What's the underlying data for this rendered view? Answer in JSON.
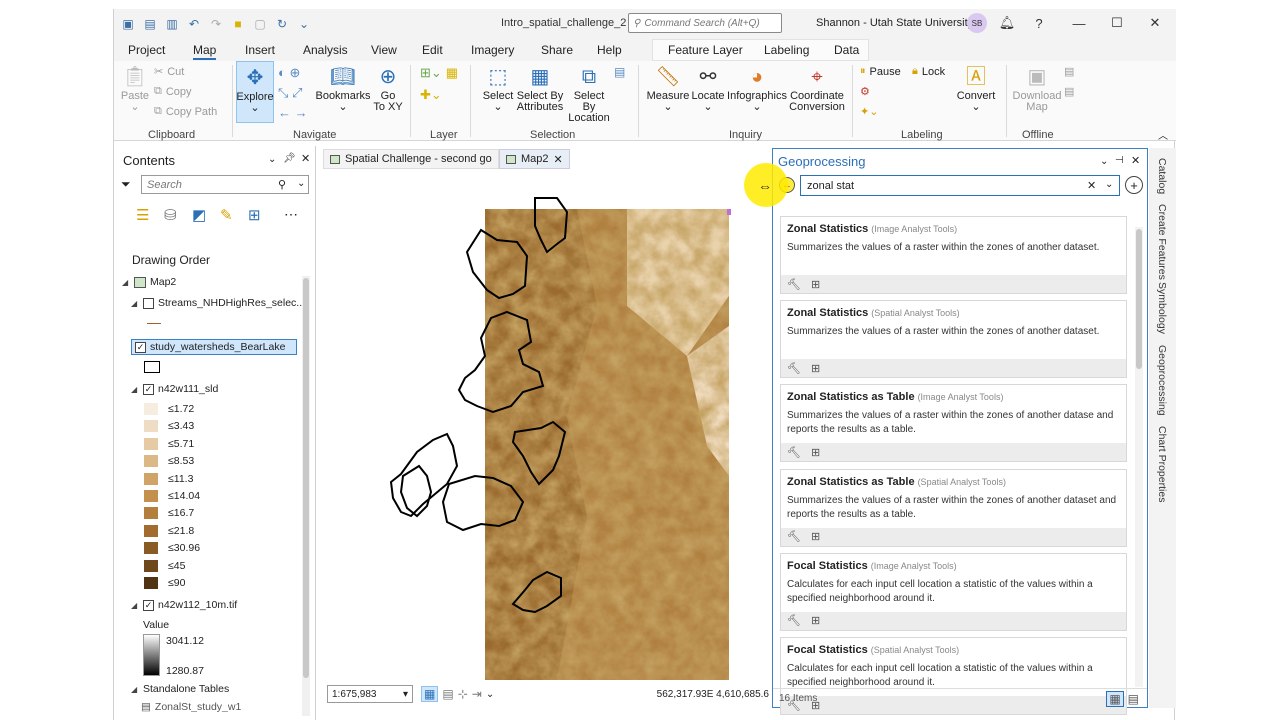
{
  "window": {
    "title": "Intro_spatial_challenge_2",
    "command_search_placeholder": "Command Search (Alt+Q)",
    "user": "Shannon - Utah State University",
    "avatar_initials": "SB",
    "help": "?"
  },
  "ribbon_tabs": [
    "Project",
    "Map",
    "Insert",
    "Analysis",
    "View",
    "Edit",
    "Imagery",
    "Share",
    "Help",
    "Feature Layer",
    "Labeling",
    "Data"
  ],
  "ribbon": {
    "clipboard": {
      "paste": "Paste",
      "cut": "Cut",
      "copy": "Copy",
      "copy_path": "Copy Path",
      "group": "Clipboard"
    },
    "navigate": {
      "explore": "Explore",
      "bookmarks": "Bookmarks",
      "go_to_xy_1": "Go",
      "go_to_xy_2": "To XY",
      "group": "Navigate"
    },
    "layer": {
      "group": "Layer"
    },
    "selection": {
      "select": "Select",
      "select_by_attr_1": "Select By",
      "select_by_attr_2": "Attributes",
      "select_by_loc_1": "Select By",
      "select_by_loc_2": "Location",
      "group": "Selection"
    },
    "inquiry": {
      "measure": "Measure",
      "locate": "Locate",
      "infographics": "Infographics",
      "coord_1": "Coordinate",
      "coord_2": "Conversion",
      "group": "Inquiry"
    },
    "labeling": {
      "pause": "Pause",
      "lock": "Lock",
      "convert": "Convert",
      "group": "Labeling"
    },
    "offline": {
      "download_1": "Download",
      "download_2": "Map",
      "group": "Offline"
    }
  },
  "contents": {
    "title": "Contents",
    "search_placeholder": "Search",
    "drawing_order": "Drawing Order",
    "map": "Map2",
    "layers": {
      "streams": "Streams_NHDHighRes_selec...",
      "watersheds": "study_watersheds_BearLake",
      "slope": "n42w111_sld",
      "dem": "n42w112_10m.tif",
      "value_label": "Value",
      "dem_max": "3041.12",
      "dem_min": "1280.87",
      "standalone": "Standalone Tables",
      "zonal_table": "ZonalSt_study_w1"
    },
    "legend": [
      {
        "label": "≤1.72",
        "color": "#f7ece0"
      },
      {
        "label": "≤3.43",
        "color": "#efdcc4"
      },
      {
        "label": "≤5.71",
        "color": "#e6caa4"
      },
      {
        "label": "≤8.53",
        "color": "#dcb886"
      },
      {
        "label": "≤11.3",
        "color": "#d0a468"
      },
      {
        "label": "≤14.04",
        "color": "#c3904e"
      },
      {
        "label": "≤16.7",
        "color": "#b47e3c"
      },
      {
        "label": "≤21.8",
        "color": "#a26c2e"
      },
      {
        "label": "≤30.96",
        "color": "#8a5a24"
      },
      {
        "label": "≤45",
        "color": "#6e471b"
      },
      {
        "label": "≤90",
        "color": "#503312"
      }
    ]
  },
  "map_tabs": [
    "Spatial Challenge - second go",
    "Map2"
  ],
  "map_status": {
    "scale": "1:675,983",
    "coords": "562,317.93E 4,610,685.6"
  },
  "geoprocessing": {
    "title": "Geoprocessing",
    "search_value": "zonal stat",
    "results": [
      {
        "title": "Zonal Statistics",
        "source": "(Image Analyst Tools)",
        "desc": "Summarizes the values of a raster within the zones of another dataset."
      },
      {
        "title": "Zonal Statistics",
        "source": "(Spatial Analyst Tools)",
        "desc": "Summarizes the values of a raster within the zones of another dataset."
      },
      {
        "title": "Zonal Statistics as Table",
        "source": "(Image Analyst Tools)",
        "desc": "Summarizes the values of a raster within the zones of another datase and reports the results as a table."
      },
      {
        "title": "Zonal Statistics as Table",
        "source": "(Spatial Analyst Tools)",
        "desc": "Summarizes the values of a raster within the zones of another dataset and reports the results as a table."
      },
      {
        "title": "Focal Statistics",
        "source": "(Image Analyst Tools)",
        "desc": "Calculates for each input cell location a statistic of the values within a specified neighborhood around it."
      },
      {
        "title": "Focal Statistics",
        "source": "(Spatial Analyst Tools)",
        "desc": "Calculates for each input cell location a statistic of the values within a specified neighborhood around it."
      }
    ],
    "count": "16 Items"
  },
  "side_tabs": [
    "Catalog",
    "Create Features",
    "Symbology",
    "Geoprocessing",
    "Chart Properties"
  ]
}
